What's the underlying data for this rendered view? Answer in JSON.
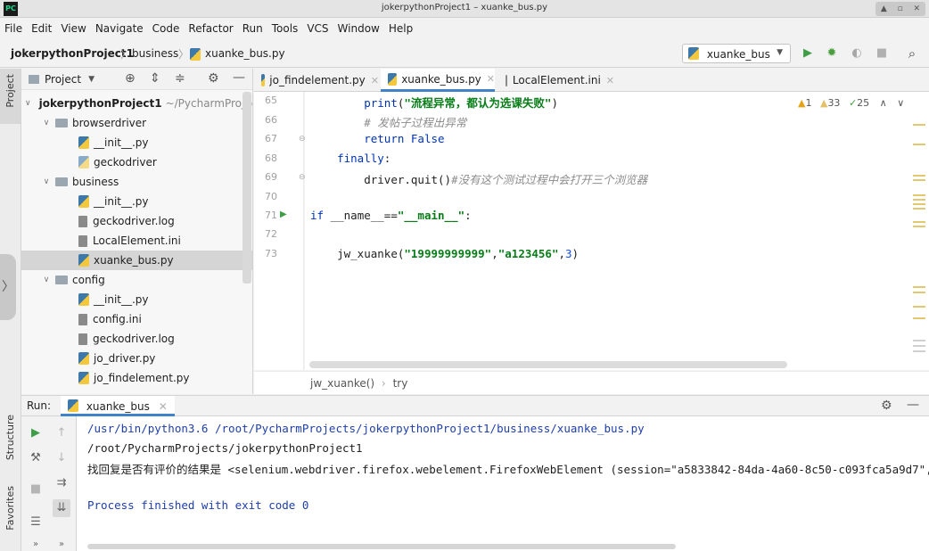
{
  "window": {
    "title": "jokerpythonProject1 – xuanke_bus.py",
    "logo": "PC"
  },
  "menu": [
    "File",
    "Edit",
    "View",
    "Navigate",
    "Code",
    "Refactor",
    "Run",
    "Tools",
    "VCS",
    "Window",
    "Help"
  ],
  "breadcrumbs": {
    "project": "jokerpythonProject1",
    "folder": "business",
    "file": "xuanke_bus.py"
  },
  "run_config": {
    "label": "xuanke_bus"
  },
  "left_stripe": {
    "project": "Project",
    "structure": "Structure",
    "favorites": "Favorites"
  },
  "project_panel": {
    "header": "Project",
    "tree": [
      {
        "label": "jokerpythonProject1",
        "suffix": "~/PycharmProjects/",
        "type": "root"
      },
      {
        "label": "browserdriver",
        "type": "folder"
      },
      {
        "label": "__init__.py",
        "type": "py"
      },
      {
        "label": "geckodriver",
        "type": "file"
      },
      {
        "label": "business",
        "type": "folder"
      },
      {
        "label": "__init__.py",
        "type": "py"
      },
      {
        "label": "geckodriver.log",
        "type": "file"
      },
      {
        "label": "LocalElement.ini",
        "type": "file"
      },
      {
        "label": "xuanke_bus.py",
        "type": "py",
        "selected": true
      },
      {
        "label": "config",
        "type": "folder"
      },
      {
        "label": "__init__.py",
        "type": "py"
      },
      {
        "label": "config.ini",
        "type": "file"
      },
      {
        "label": "geckodriver.log",
        "type": "file"
      },
      {
        "label": "jo_driver.py",
        "type": "py"
      },
      {
        "label": "jo_findelement.py",
        "type": "py"
      }
    ]
  },
  "editor": {
    "tabs": [
      {
        "label": "jo_findelement.py",
        "active": false
      },
      {
        "label": "xuanke_bus.py",
        "active": true
      },
      {
        "label": "LocalElement.ini",
        "active": false
      }
    ],
    "inspections": {
      "errors": "1",
      "warnings": "33",
      "typos": "25"
    },
    "lines": [
      {
        "num": "65",
        "indent": "        ",
        "fn": "print",
        "str": "\"流程异常，都认为选课失败\""
      },
      {
        "num": "66",
        "indent": "        ",
        "comment": "# 发帖子过程出异常"
      },
      {
        "num": "67",
        "indent": "        ",
        "kw": "return",
        "rest": " False"
      },
      {
        "num": "68",
        "indent": "    ",
        "kw": "finally",
        "rest": ":"
      },
      {
        "num": "69",
        "indent": "        ",
        "code": "driver.quit()",
        "comment": "#没有这个测试过程中会打开三个浏览器"
      },
      {
        "num": "70"
      },
      {
        "num": "71",
        "kw": "if",
        "rest": " __name__==",
        "str": "\"__main__\"",
        "tail": ":"
      },
      {
        "num": "72"
      },
      {
        "num": "73",
        "indent": "    ",
        "code": "jw_xuanke(",
        "str1": "\"19999999999\"",
        "str2": "\"a123456\"",
        "n": "3",
        "tail": ")"
      }
    ],
    "breadcrumb": {
      "func": "jw_xuanke()",
      "block": "try"
    }
  },
  "run": {
    "label": "Run:",
    "tab": "xuanke_bus",
    "console": [
      "/usr/bin/python3.6 /root/PycharmProjects/jokerpythonProject1/business/xuanke_bus.py",
      "/root/PycharmProjects/jokerpythonProject1",
      "找回复是否有评价的结果是 <selenium.webdriver.firefox.webelement.FirefoxWebElement (session=\"a5833842-84da-4a60-8c50-c093fca5a9d7\",",
      "Process finished with exit code 0"
    ]
  }
}
